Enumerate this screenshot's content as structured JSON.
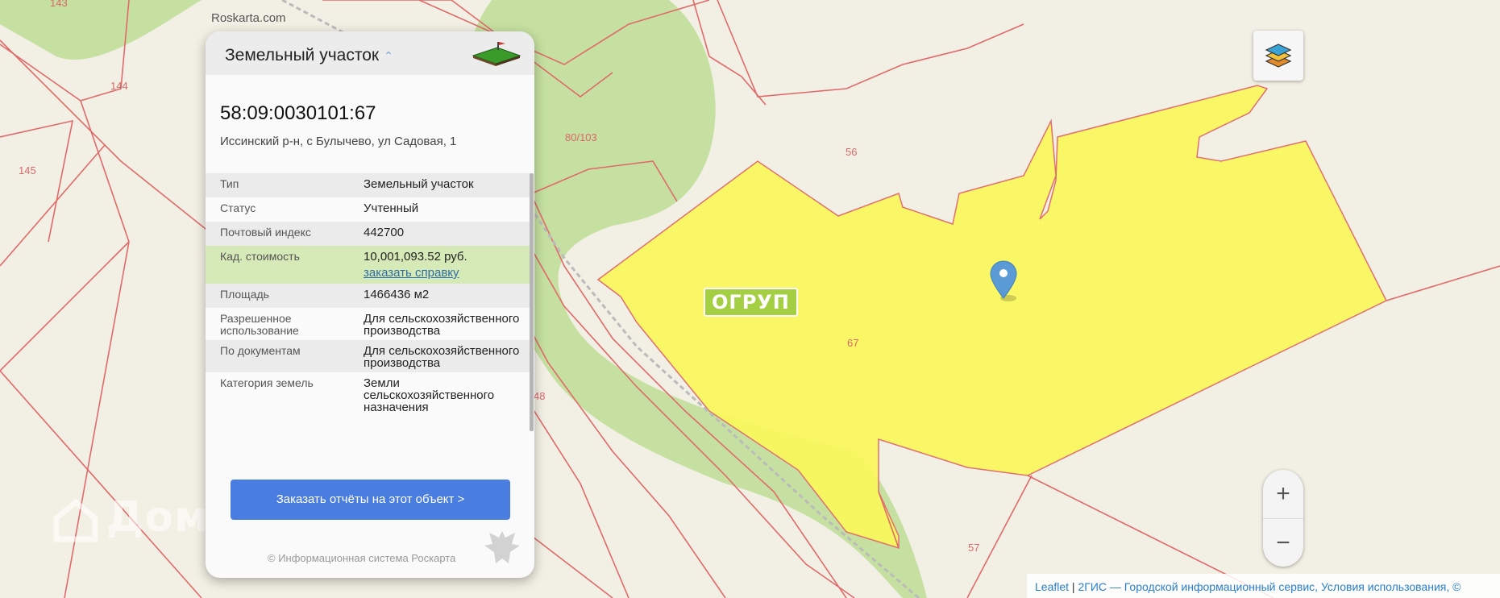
{
  "site": {
    "label": "Roskarta.com"
  },
  "map": {
    "parcel_numbers": [
      "143",
      "144",
      "145",
      "80/103",
      "56",
      "67",
      "48",
      "57"
    ],
    "overlay_label": "ОГРУП",
    "watermark": "Домклик",
    "highlight_color": "#f9f75e",
    "border_color": "#e06060",
    "forest_color": "#c5e0a0"
  },
  "card": {
    "header_title": "Земельный участок",
    "cadastral_number": "58:09:0030101:67",
    "address": "Иссинский р-н, с Булычево, ул Садовая, 1",
    "properties": [
      {
        "key": "Тип",
        "value": "Земельный участок"
      },
      {
        "key": "Статус",
        "value": "Учтенный"
      },
      {
        "key": "Почтовый индекс",
        "value": "442700"
      },
      {
        "key": "Кад. стоимость",
        "value": "10,001,093.52 руб.",
        "link": "заказать справку"
      },
      {
        "key": "Площадь",
        "value": "1466436 м2"
      },
      {
        "key": "Разрешенное использование",
        "value": "Для сельскохозяйственного производства"
      },
      {
        "key": "По документам",
        "value": "Для сельскохозяйственного производства"
      },
      {
        "key": "Категория земель",
        "value": "Земли сельскохозяйственного назначения"
      }
    ],
    "order_button": "Заказать отчёты на этот объект >",
    "footer": "© Информационная система Роскарта",
    "accent_color": "#4a7de0"
  },
  "controls": {
    "zoom_in": "+",
    "zoom_out": "−",
    "layers_icon": "layers-icon"
  },
  "attribution": {
    "leaflet": "Leaflet",
    "separator": " | ",
    "text": "2ГИС — Городской информационный сервис, Условия использования, ©"
  }
}
